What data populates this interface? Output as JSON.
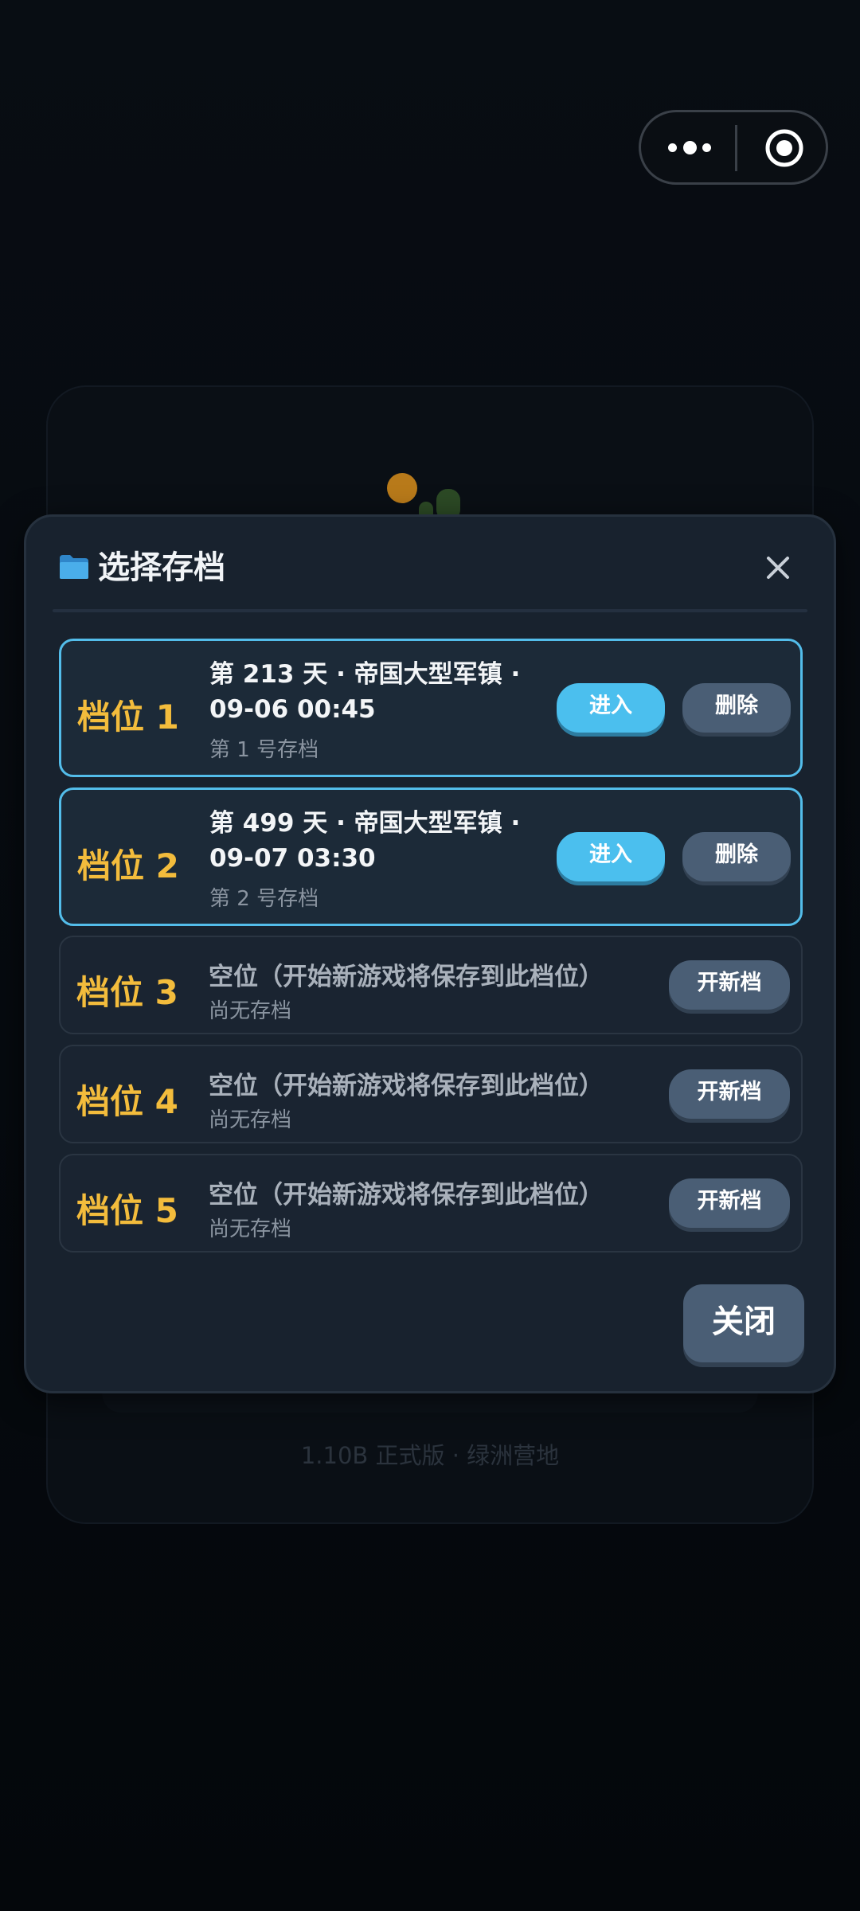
{
  "background": {
    "footer_text": "1.10B 正式版 · 绿洲营地"
  },
  "dialog": {
    "title": "选择存档",
    "close_label": "关闭",
    "slots": [
      {
        "name": "档位 1",
        "line1": "第 213 天 · 帝国大型军镇 ·",
        "line2": "09-06 00:45",
        "sub": "第 1 号存档",
        "enter": "进入",
        "delete": "删除"
      },
      {
        "name": "档位 2",
        "line1": "第 499 天 · 帝国大型军镇 ·",
        "line2": "09-07 03:30",
        "sub": "第 2 号存档",
        "enter": "进入",
        "delete": "删除"
      },
      {
        "name": "档位 3",
        "main": "空位（开始新游戏将保存到此档位）",
        "sub": "尚无存档",
        "new": "开新档"
      },
      {
        "name": "档位 4",
        "main": "空位（开始新游戏将保存到此档位）",
        "sub": "尚无存档",
        "new": "开新档"
      },
      {
        "name": "档位 5",
        "main": "空位（开始新游戏将保存到此档位）",
        "sub": "尚无存档",
        "new": "开新档"
      }
    ]
  },
  "colors": {
    "accent": "#4bbfee",
    "slot_name": "#f3bc3c",
    "button": "#4a5e75",
    "dialog_bg": "#18222e"
  },
  "icons": {
    "title": "folder-icon",
    "close": "close-icon",
    "capsule_menu": "more-dots-icon",
    "capsule_exit": "target-icon"
  }
}
